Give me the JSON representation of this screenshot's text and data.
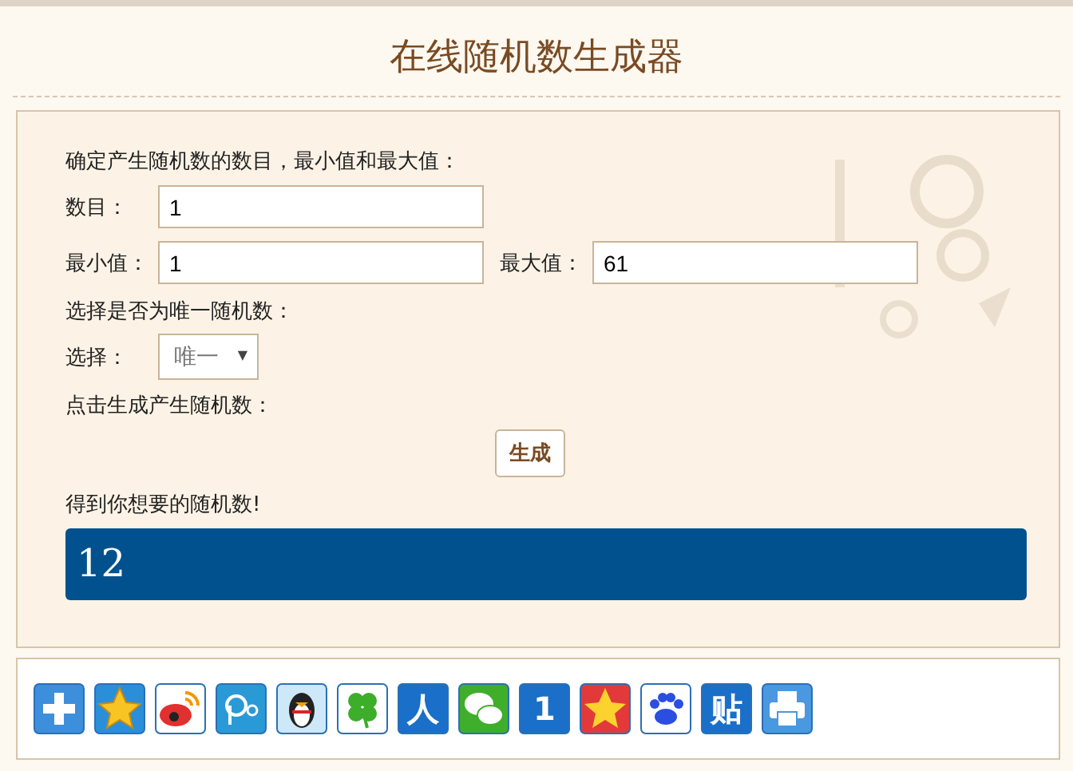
{
  "title": "在线随机数生成器",
  "form": {
    "intro": "确定产生随机数的数目，最小值和最大值：",
    "count": {
      "label": "数目：",
      "value": "1"
    },
    "min": {
      "label": "最小值：",
      "value": "1"
    },
    "max": {
      "label": "最大值：",
      "value": "61"
    },
    "unique_prompt": "选择是否为唯一随机数：",
    "select": {
      "label": "选择：",
      "value": "唯一",
      "caret": "▼"
    },
    "click_prompt": "点击生成产生随机数：",
    "generate_button": "生成",
    "result_label": "得到你想要的随机数!",
    "result": "12"
  },
  "share_icons": [
    {
      "kind": "plus"
    },
    {
      "kind": "star"
    },
    {
      "kind": "weibo"
    },
    {
      "kind": "swirl"
    },
    {
      "kind": "penguin"
    },
    {
      "kind": "clover"
    },
    {
      "kind": "glyph",
      "glyph": "人"
    },
    {
      "kind": "chat"
    },
    {
      "kind": "glyph",
      "glyph": "1"
    },
    {
      "kind": "smile-star"
    },
    {
      "kind": "paw"
    },
    {
      "kind": "glyph",
      "glyph": "贴"
    },
    {
      "kind": "printer"
    }
  ]
}
